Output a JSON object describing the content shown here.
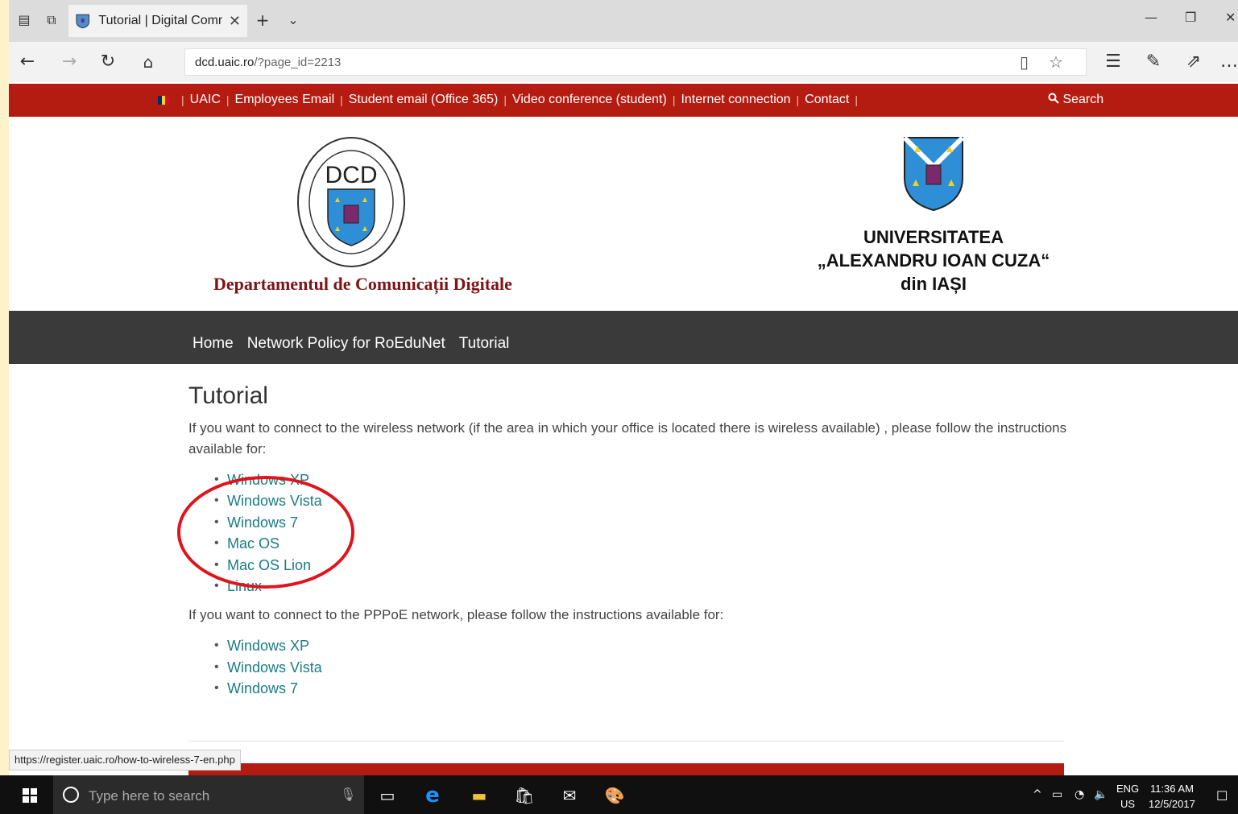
{
  "browser": {
    "tab_title": "Tutorial | Digital Commı",
    "url_domain": "dcd.uaic.ro",
    "url_path": "/?page_id=2213",
    "status_url": "https://register.uaic.ro/how-to-wireless-7-en.php"
  },
  "top_nav": {
    "items": [
      "UAIC",
      "Employees Email",
      "Student email (Office 365)",
      "Video conference (student)",
      "Internet connection",
      "Contact"
    ],
    "separator": "|",
    "search_label": "Search"
  },
  "header": {
    "dcd_logo_text": "DCD",
    "dcd_name": "Departamentul de Comunicații Digitale",
    "uaic_line1": "UNIVERSITATEA",
    "uaic_line2": "„ALEXANDRU IOAN CUZA“",
    "uaic_line3": "din IAȘI"
  },
  "main_nav": {
    "items": [
      "Home",
      "Network Policy for RoEduNet",
      "Tutorial"
    ]
  },
  "content": {
    "title": "Tutorial",
    "wireless_intro": "If you want to connect to the wireless network (if the area in which your office is located there is wireless available) , please follow the instructions available for:",
    "wireless_links": [
      "Windows XP",
      "Windows Vista",
      "Windows 7",
      "Mac OS",
      "Mac OS Lion",
      "Linux"
    ],
    "pppoe_intro": "If you want to connect to the PPPoE network, please follow the instructions available for:",
    "pppoe_links": [
      "Windows XP",
      "Windows Vista",
      "Windows 7"
    ]
  },
  "taskbar": {
    "search_placeholder": "Type here to search",
    "lang_top": "ENG",
    "lang_bottom": "US",
    "time": "11:36 AM",
    "date": "12/5/2017"
  },
  "colors": {
    "site_red": "#b51c11",
    "nav_dark": "#3a3a3a",
    "link_teal": "#1a7c84",
    "dcd_maroon": "#7d1416",
    "annotation_red": "#e0141b"
  }
}
